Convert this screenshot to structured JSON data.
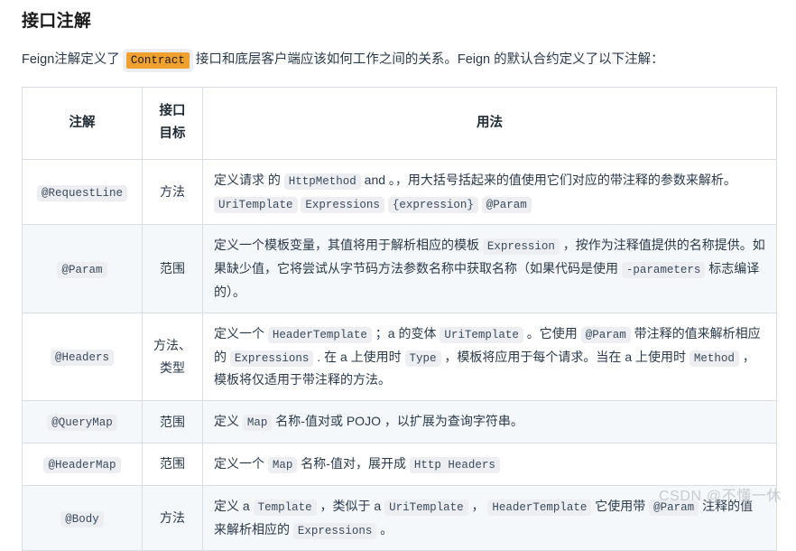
{
  "page": {
    "title": "接口注解",
    "intro_parts": [
      {
        "type": "text",
        "value": "Feign注解定义了 "
      },
      {
        "type": "code_hl",
        "value": "Contract"
      },
      {
        "type": "text",
        "value": " 接口和底层客户端应该如何工作之间的关系。Feign 的默认合约定义了以下注解："
      }
    ],
    "intro_plain": "Feign注解定义了 Contract 接口和底层客户端应该如何工作之间的关系。Feign 的默认合约定义了以下注解：",
    "watermark": "CSDN @不懂一休"
  },
  "table": {
    "headers": {
      "annotation": "注解",
      "interface_target": "接口目标",
      "usage": "用法"
    },
    "rows": [
      {
        "annotation": "@RequestLine",
        "target": "方法",
        "usage_parts": [
          {
            "type": "text",
            "value": "定义请求 的 "
          },
          {
            "type": "code",
            "value": "HttpMethod"
          },
          {
            "type": "text",
            "value": " and 。，用大括号括起来的值使用它们对应的带注释的参数来解析。 "
          },
          {
            "type": "code",
            "value": "UriTemplate"
          },
          {
            "type": "text",
            "value": " "
          },
          {
            "type": "code",
            "value": "Expressions"
          },
          {
            "type": "text",
            "value": " "
          },
          {
            "type": "code",
            "value": "{expression}"
          },
          {
            "type": "text",
            "value": " "
          },
          {
            "type": "code",
            "value": "@Param"
          }
        ],
        "usage_plain": "定义请求 的 HttpMethod and 。，用大括号括起来的值使用它们对应的带注释的参数来解析。 UriTemplate Expressions {expression} @Param",
        "striped": false
      },
      {
        "annotation": "@Param",
        "target": "范围",
        "usage_parts": [
          {
            "type": "text",
            "value": "定义一个模板变量，其值将用于解析相应的模板 "
          },
          {
            "type": "code",
            "value": "Expression"
          },
          {
            "type": "text",
            "value": " ，按作为注释值提供的名称提供。如果缺少值，它将尝试从字节码方法参数名称中获取名称（如果代码是使用 "
          },
          {
            "type": "code",
            "value": "-parameters"
          },
          {
            "type": "text",
            "value": " 标志编译的）。"
          }
        ],
        "usage_plain": "定义一个模板变量，其值将用于解析相应的模板 Expression ，按作为注释值提供的名称提供。如果缺少值，它将尝试从字节码方法参数名称中获取名称（如果代码是使用 -parameters 标志编译的）。",
        "striped": true
      },
      {
        "annotation": "@Headers",
        "target": "方法、类型",
        "usage_parts": [
          {
            "type": "text",
            "value": "定义一个 "
          },
          {
            "type": "code",
            "value": "HeaderTemplate"
          },
          {
            "type": "text",
            "value": " ；a 的变体 "
          },
          {
            "type": "code",
            "value": "UriTemplate"
          },
          {
            "type": "text",
            "value": " 。它使用 "
          },
          {
            "type": "code",
            "value": "@Param"
          },
          {
            "type": "text",
            "value": " 带注释的值来解析相应的 "
          },
          {
            "type": "code",
            "value": "Expressions"
          },
          {
            "type": "text",
            "value": " . 在 a 上使用时 "
          },
          {
            "type": "code",
            "value": "Type"
          },
          {
            "type": "text",
            "value": " ，模板将应用于每个请求。当在 a 上使用时 "
          },
          {
            "type": "code",
            "value": "Method"
          },
          {
            "type": "text",
            "value": " ，模板将仅适用于带注释的方法。"
          }
        ],
        "usage_plain": "定义一个 HeaderTemplate ；a 的变体 UriTemplate 。它使用 @Param 带注释的值来解析相应的 Expressions . 在 a 上使用时 Type ，模板将应用于每个请求。当在 a 上使用时 Method ，模板将仅适用于带注释的方法。",
        "striped": false
      },
      {
        "annotation": "@QueryMap",
        "target": "范围",
        "usage_parts": [
          {
            "type": "text",
            "value": "定义 "
          },
          {
            "type": "code",
            "value": "Map"
          },
          {
            "type": "text",
            "value": " 名称-值对或 POJO ，以扩展为查询字符串。"
          }
        ],
        "usage_plain": "定义 Map 名称-值对或 POJO ，以扩展为查询字符串。",
        "striped": true
      },
      {
        "annotation": "@HeaderMap",
        "target": "范围",
        "usage_parts": [
          {
            "type": "text",
            "value": "定义一个 "
          },
          {
            "type": "code",
            "value": "Map"
          },
          {
            "type": "text",
            "value": " 名称-值对，展开成 "
          },
          {
            "type": "code",
            "value": "Http Headers"
          }
        ],
        "usage_plain": "定义一个 Map 名称-值对，展开成 Http Headers",
        "striped": false
      },
      {
        "annotation": "@Body",
        "target": "方法",
        "usage_parts": [
          {
            "type": "text",
            "value": "定义 a "
          },
          {
            "type": "code",
            "value": "Template"
          },
          {
            "type": "text",
            "value": " ，类似于 a "
          },
          {
            "type": "code",
            "value": "UriTemplate"
          },
          {
            "type": "text",
            "value": " ， "
          },
          {
            "type": "code",
            "value": "HeaderTemplate"
          },
          {
            "type": "text",
            "value": " 它使用带 "
          },
          {
            "type": "code",
            "value": "@Param"
          },
          {
            "type": "text",
            "value": " 注释的值来解析相应的 "
          },
          {
            "type": "code",
            "value": "Expressions"
          },
          {
            "type": "text",
            "value": " 。"
          }
        ],
        "usage_plain": "定义 a Template ，类似于 a UriTemplate ， HeaderTemplate 它使用带 @Param 注释的值来解析相应的 Expressions 。",
        "striped": true
      }
    ]
  },
  "colors": {
    "accent_highlight": "#f0a02e",
    "code_background": "#eceef1",
    "table_border": "#d9dee5",
    "stripe_background": "#f5f8fb",
    "text": "#2b3a4a",
    "watermark": "#c6cbd1"
  }
}
